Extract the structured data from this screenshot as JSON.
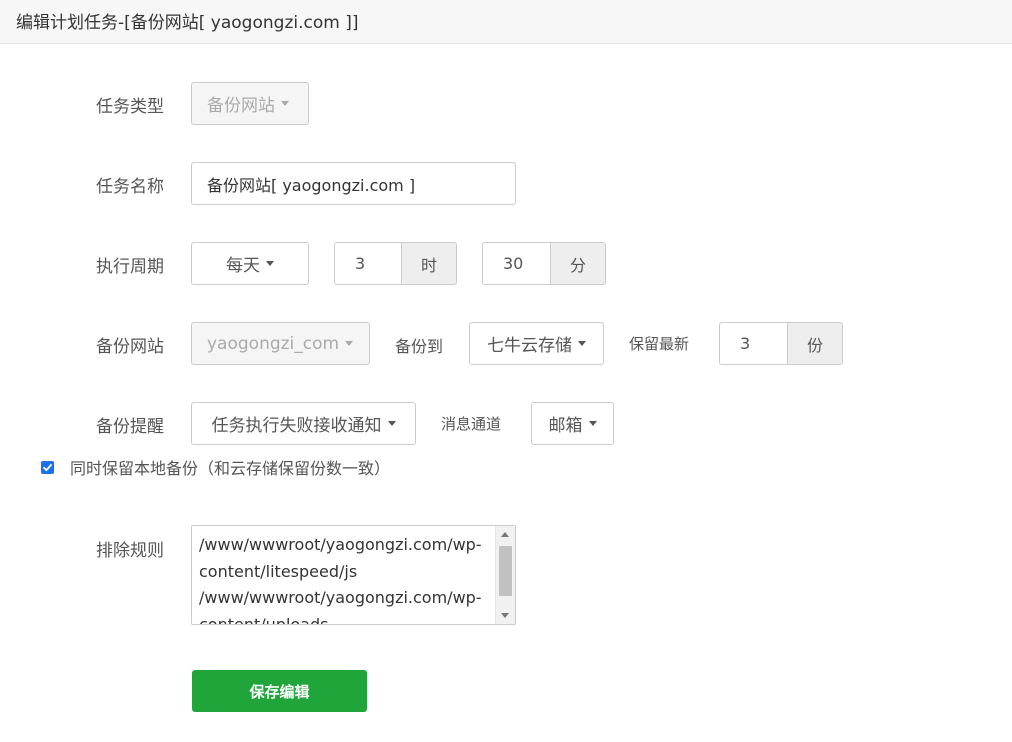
{
  "header": {
    "title": "编辑计划任务-[备份网站[ yaogongzi.com ]]"
  },
  "form": {
    "task_type": {
      "label": "任务类型",
      "value": "备份网站"
    },
    "task_name": {
      "label": "任务名称",
      "value": "备份网站[ yaogongzi.com ]"
    },
    "cycle": {
      "label": "执行周期",
      "period": "每天",
      "hour_value": "3",
      "hour_unit": "时",
      "minute_value": "30",
      "minute_unit": "分"
    },
    "backup_site": {
      "label": "备份网站",
      "site": "yaogongzi_com",
      "target_label": "备份到",
      "target": "七牛云存储",
      "keep_label": "保留最新",
      "keep_value": "3",
      "keep_unit": "份"
    },
    "notify": {
      "label": "备份提醒",
      "value": "任务执行失败接收通知",
      "channel_label": "消息通道",
      "channel": "邮箱"
    },
    "keep_local": {
      "checked": true,
      "label": "同时保留本地备份（和云存储保留份数一致）"
    },
    "exclude": {
      "label": "排除规则",
      "lines": [
        "/www/wwwroot/yaogongzi.com/wp-",
        "content/litespeed/js",
        "/www/wwwroot/yaogongzi.com/wp-",
        "content/uploads"
      ]
    },
    "save_label": "保存编辑"
  },
  "colors": {
    "primary_button": "#20a53a",
    "checkbox": "#1a73e8"
  }
}
